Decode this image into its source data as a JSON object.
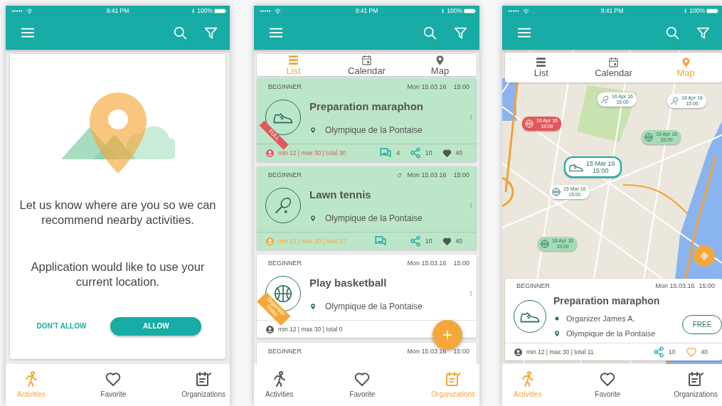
{
  "screens": [
    {
      "kind": "permission",
      "status_bar": {
        "time": "9:41 PM",
        "battery": "100%"
      },
      "prompt": {
        "message": "Let us know where are you so we can recommend nearby activities.",
        "request": "Application would like to use your current location.",
        "buttons": [
          {
            "label": "DON'T ALLOW",
            "kind": "text"
          },
          {
            "label": "ALLOW",
            "kind": "filled"
          }
        ]
      },
      "bottom_nav": [
        {
          "label": "Activities",
          "selected": true
        },
        {
          "label": "Favorite",
          "selected": false
        },
        {
          "label": "Organizations",
          "selected": false
        }
      ]
    },
    {
      "kind": "list",
      "status_bar": {
        "time": "9:41 PM",
        "battery": "100%"
      },
      "view_tabs": [
        {
          "label": "List",
          "selected": true
        },
        {
          "label": "Calendar",
          "selected": false
        },
        {
          "label": "Map",
          "selected": false
        }
      ],
      "cards": [
        {
          "level": "BEGINNER",
          "date": "Mon 15.03.16",
          "time": "15:00",
          "highlighted": true,
          "repeat": false,
          "title": "Preparation maraphon",
          "location": "Olympique de la Pontaise",
          "ribbon": {
            "label": "FULL",
            "color": "#e0585a"
          },
          "participants": {
            "text": "min 12 | max 30 | total 30",
            "color": "#e0585a"
          },
          "actions": [
            {
              "kind": "comment",
              "count": "4"
            },
            {
              "kind": "share",
              "count": "10"
            },
            {
              "kind": "like",
              "count": "40"
            }
          ]
        },
        {
          "level": "BEGINNER",
          "date": "Mon 15.03.16",
          "time": "15:00",
          "highlighted": true,
          "repeat": true,
          "title": "Lawn tennis",
          "location": "Olympique de la Pontaise",
          "participants": {
            "text": "min 12 | max 30 | total 17",
            "color": "#f5a83a"
          },
          "actions": [
            {
              "kind": "comment"
            },
            {
              "kind": "share",
              "count": "10"
            },
            {
              "kind": "like",
              "count": "40"
            }
          ]
        },
        {
          "level": "BEGINNER",
          "date": "Mon 15.03.16",
          "time": "15:00",
          "highlighted": false,
          "repeat": false,
          "title": "Play basketball",
          "location": "Olympique de la Pontaise",
          "ribbon": {
            "label": "Organizer notes",
            "color": "#f5a83a"
          },
          "participants": {
            "text": "min 12 | max 30 | total 0",
            "color": "#555555"
          }
        },
        {
          "level": "BEGINNER",
          "date": "Mon 15.03.16",
          "time": "15:00",
          "highlighted": false,
          "repeat": false
        }
      ],
      "bottom_nav": [
        {
          "label": "Activities",
          "selected": false
        },
        {
          "label": "Favorite",
          "selected": false
        },
        {
          "label": "Organizations",
          "selected": true
        }
      ]
    },
    {
      "kind": "map",
      "status_bar": {
        "time": "9:41 PM",
        "battery": "100%"
      },
      "view_tabs": [
        {
          "label": "List",
          "selected": false
        },
        {
          "label": "Calendar",
          "selected": false
        },
        {
          "label": "Map",
          "selected": true
        }
      ],
      "map_markers": [
        {
          "date": "16 Apr 16",
          "time": "15:00",
          "color": "#ffffff",
          "selected": false
        },
        {
          "date": "16 Apr 16",
          "time": "15:00",
          "color": "#ffffff",
          "selected": false
        },
        {
          "date": "16 Apr 16",
          "time": "15:00",
          "color": "#e0585a",
          "selected": false
        },
        {
          "date": "16 Apr 16",
          "time": "15:00",
          "color": "#a6dcb5",
          "selected": false
        },
        {
          "date": "15 Mar 16",
          "time": "15:00",
          "color": "#ffffff",
          "selected": true
        },
        {
          "date": "15 Mar 16",
          "time": "15:00",
          "color": "#ffffff",
          "selected": false
        },
        {
          "date": "16 Apr 16",
          "time": "15:00",
          "color": "#a6dcb5",
          "selected": false
        }
      ],
      "detail_card": {
        "level": "BEGINNER",
        "date": "Mon 15.03.16",
        "time": "15:00",
        "title": "Preparation maraphon",
        "organizer": "Organizer James A.",
        "location": "Olympique de la Pontaise",
        "price": "FREE",
        "participants": {
          "text": "min 12 | max 30 | total 11",
          "color": "#555555"
        },
        "actions": [
          {
            "kind": "share",
            "count": "10"
          },
          {
            "kind": "like",
            "count": "40"
          }
        ]
      },
      "bottom_nav": [
        {
          "label": "Activities",
          "selected": true
        },
        {
          "label": "Favorite",
          "selected": false
        },
        {
          "label": "Organizations",
          "selected": false
        }
      ]
    }
  ]
}
